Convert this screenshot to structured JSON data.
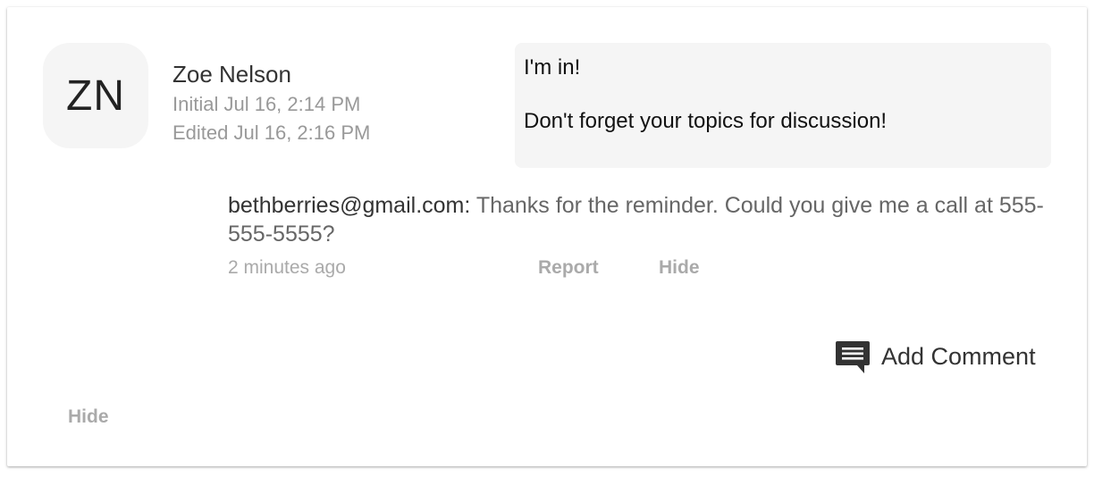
{
  "comment": {
    "avatar_initials": "ZN",
    "author": "Zoe Nelson",
    "initial_time": "Initial Jul 16, 2:14 PM",
    "edited_time": "Edited Jul 16, 2:16 PM",
    "message": {
      "line1": "I'm in!",
      "line2": "Don't forget your topics for discussion!"
    }
  },
  "reply": {
    "author": "bethberries@gmail.com:",
    "text": " Thanks for the reminder.  Could you give me a call at 555-555-5555?",
    "time": "2 minutes ago",
    "report_label": "Report",
    "hide_label": "Hide"
  },
  "actions": {
    "add_comment_label": "Add Comment",
    "add_comment_icon": "comment-icon",
    "hide_label": "Hide"
  },
  "colors": {
    "avatar_bg": "#f5f5f5",
    "message_bg": "#f5f5f5",
    "muted_text": "#999999",
    "link_text": "#aaaaaa",
    "icon": "#333333"
  }
}
